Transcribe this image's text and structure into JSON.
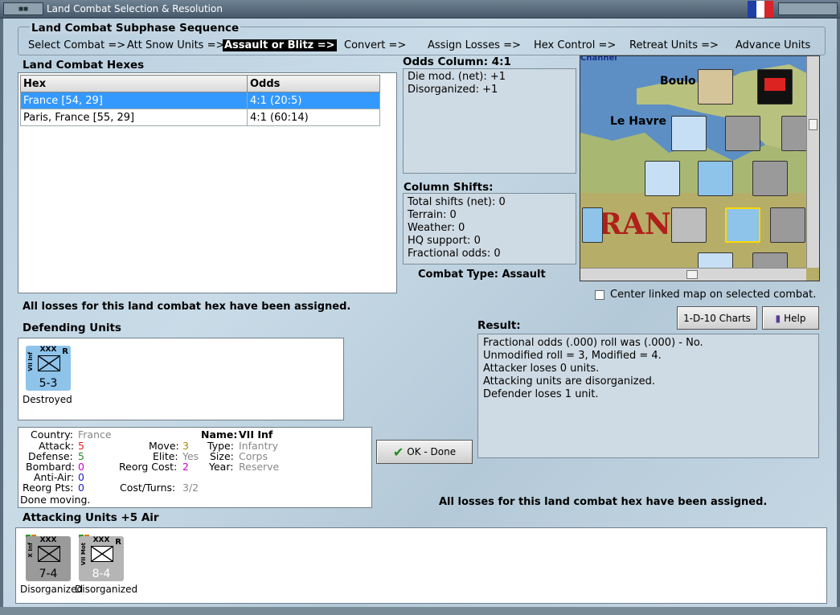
{
  "window": {
    "title": "Land Combat Selection & Resolution"
  },
  "sequence": {
    "title": "Land Combat Subphase Sequence",
    "steps": [
      "Select Combat =>",
      "Att Snow Units =>",
      "Assault or Blitz =>",
      "Convert =>",
      "Assign Losses =>",
      "Hex Control =>",
      "Retreat Units =>",
      "Advance Units"
    ],
    "active_index": 2
  },
  "hexes": {
    "title": "Land Combat Hexes",
    "columns": [
      "Hex",
      "Odds"
    ],
    "rows": [
      {
        "hex": "France [54, 29]",
        "odds": "4:1 (20:5)",
        "selected": true
      },
      {
        "hex": "Paris, France [55, 29]",
        "odds": "4:1 (60:14)",
        "selected": false
      }
    ]
  },
  "odds": {
    "title": "Odds Column: 4:1",
    "lines": [
      "Die mod. (net): +1",
      "Disorganized: +1"
    ]
  },
  "shifts": {
    "title": "Column Shifts:",
    "lines": [
      "Total shifts (net): 0",
      "Terrain: 0",
      "Weather: 0",
      "HQ support: 0",
      "Fractional odds: 0"
    ]
  },
  "combat_type": "Combat Type:  Assault",
  "losses_msg": "All losses for this land combat hex have been assigned.",
  "losses_msg2": "All losses for this land combat hex have been assigned.",
  "map": {
    "labels": [
      "Boulo",
      "Le Havre",
      "RANC",
      "Channel"
    ],
    "center_checkbox": "Center linked map on selected combat."
  },
  "buttons": {
    "charts": "1-D-10 Charts",
    "help": "Help",
    "ok": "OK - Done"
  },
  "defending": {
    "title": "Defending Units",
    "units": [
      {
        "name": "VII Inf",
        "size": "XXX",
        "value": "5-3",
        "flag": "R",
        "status": "Destroyed"
      }
    ]
  },
  "unit_info": {
    "country_label": "Country:",
    "country": "France",
    "attack_label": "Attack:",
    "attack": "5",
    "defense_label": "Defense:",
    "defense": "5",
    "bombard_label": "Bombard:",
    "bombard": "0",
    "antiair_label": "Anti-Air:",
    "antiair": "0",
    "reorg_label": "Reorg Pts:",
    "reorg": "0",
    "done": "Done moving.",
    "move_label": "Move:",
    "move": "3",
    "elite_label": "Elite:",
    "elite": "Yes",
    "reorgcost_label": "Reorg Cost:",
    "reorgcost": "2",
    "costturns_label": "Cost/Turns:",
    "costturns": "3/2",
    "name_label": "Name:",
    "name": "VII Inf",
    "type_label": "Type:",
    "type": "Infantry",
    "size_label": "Size:",
    "size": "Corps",
    "year_label": "Year:",
    "year": "Reserve"
  },
  "result": {
    "title": "Result:",
    "lines": [
      "Fractional odds (.000) roll was (.000)  - No.",
      "Unmodified roll = 3, Modified = 4.",
      "Attacker loses 0 units.",
      "Attacking units are disorganized.",
      "Defender loses 1 unit."
    ]
  },
  "attacking": {
    "title": "Attacking Units +5 Air",
    "units": [
      {
        "name": "X Inf",
        "size": "XXX",
        "value": "7-4",
        "flag": "",
        "status": "Disorganized"
      },
      {
        "name": "VII Mot",
        "size": "XXX",
        "value": "8-4",
        "flag": "R",
        "status": "Disorganized"
      }
    ]
  },
  "colors": {
    "selected_row": "#3399ff",
    "friendly_counter": "#8ec3ea",
    "enemy_counter": "#9a9a9a"
  }
}
